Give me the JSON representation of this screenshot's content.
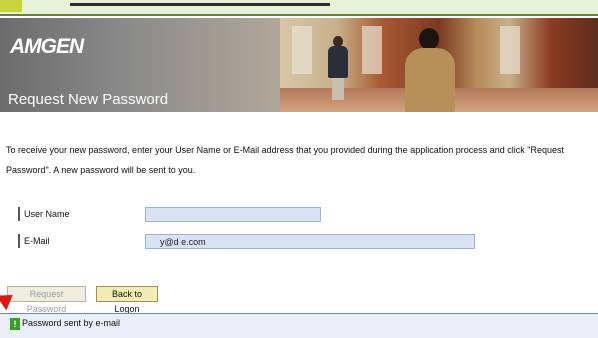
{
  "header": {
    "logo": "AMGEN",
    "title": "Request New Password"
  },
  "intro": {
    "text": "To receive your new password, enter your User Name or E-Mail address that you provided during the application process and click \"Request Password\". A new password will be sent to you."
  },
  "form": {
    "username_label": "User Name",
    "username_value": "",
    "email_label": "E-Mail",
    "email_value": "y@d e.com"
  },
  "buttons": {
    "request_password": "Request Password",
    "back_to_logon": "Back to Logon"
  },
  "message": {
    "icon": "success-icon",
    "text": "Password sent by e-mail"
  },
  "colors": {
    "input_bg": "#d9e3f3",
    "message_bar": "#e9eef7",
    "success": "#3d9b2b",
    "button_active": "#f3edb5"
  }
}
